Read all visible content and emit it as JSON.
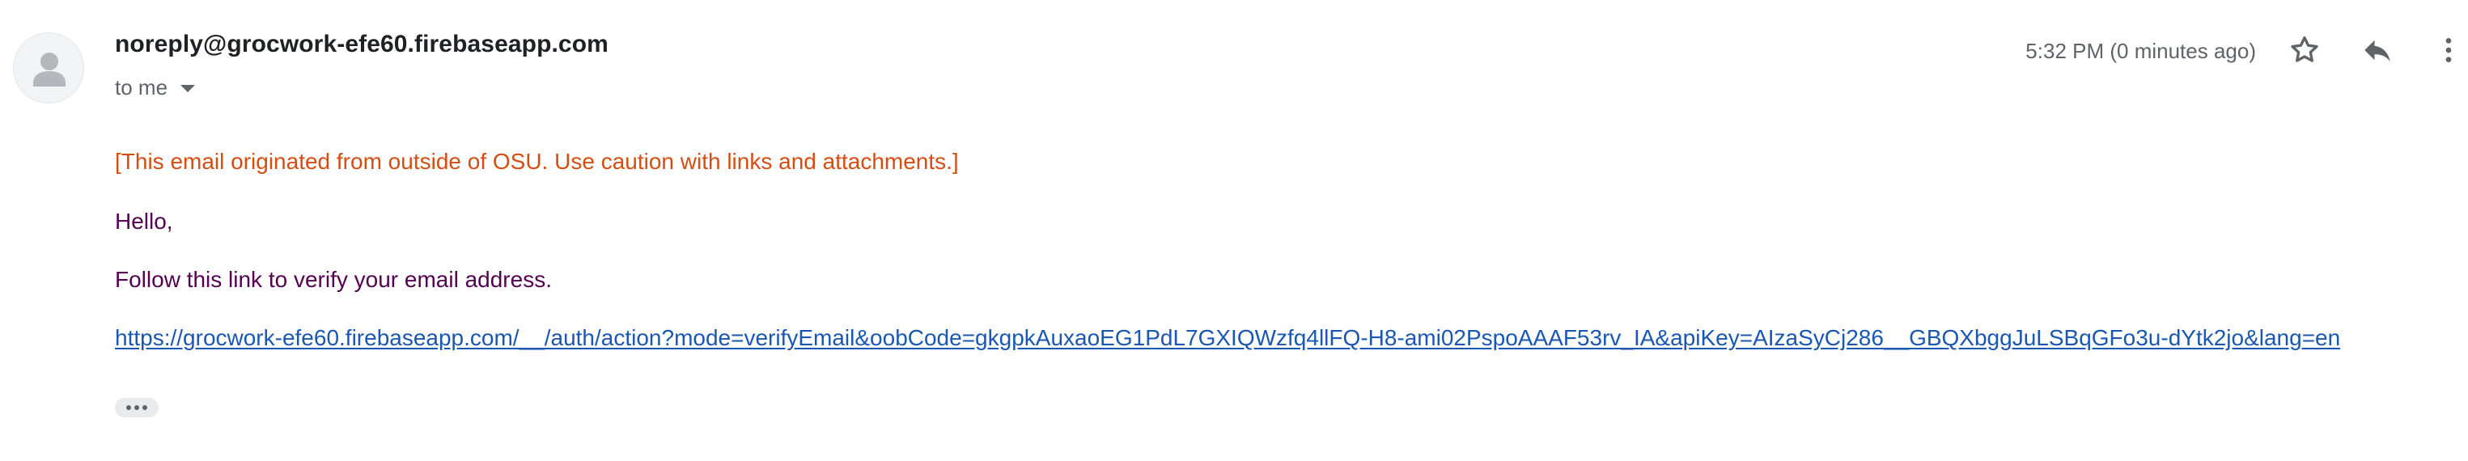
{
  "header": {
    "sender": "noreply@grocwork-efe60.firebaseapp.com",
    "recipient_label": "to me",
    "timestamp": "5:32 PM (0 minutes ago)",
    "icons": {
      "avatar": "default-avatar-icon",
      "expand": "caret-down-icon",
      "star": "star-outline-icon",
      "reply": "reply-icon",
      "more": "more-vert-icon"
    }
  },
  "body": {
    "warning": "[This email originated from outside of OSU. Use caution with links and attachments.]",
    "greeting": "Hello,",
    "instruction": "Follow this link to verify your email address.",
    "verify_link": "https://grocwork-efe60.firebaseapp.com/__/auth/action?mode=verifyEmail&oobCode=gkgpkAuxaoEG1PdL7GXIQWzfq4llFQ-H8-ami02PspoAAAF53rv_IA&apiKey=AIzaSyCj286__GBQXbggJuLSBqGFo3u-dYtk2jo&lang=en"
  },
  "colors": {
    "warning_text": "#d64d12",
    "body_text": "#550052",
    "link": "#1a57b3",
    "secondary_text": "#5f6368"
  }
}
